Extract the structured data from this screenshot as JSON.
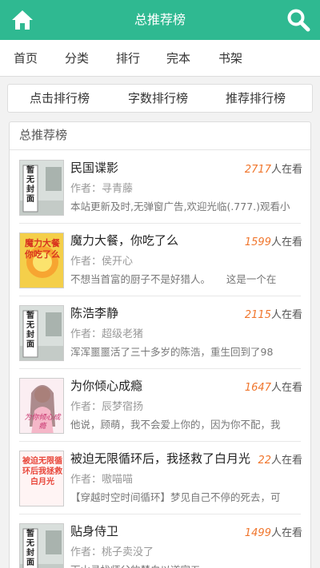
{
  "header": {
    "title": "总推荐榜"
  },
  "nav": [
    "首页",
    "分类",
    "排行",
    "完本",
    "书架"
  ],
  "tabs": [
    "点击排行榜",
    "字数排行榜",
    "推荐排行榜"
  ],
  "panel": {
    "title": "总推荐榜"
  },
  "views_suffix": "人在看",
  "books": [
    {
      "title": "民国谍影",
      "views": "2717",
      "author": "作者：寻青藤",
      "desc": "本站更新及时,无弹窗广告,欢迎光临(.777.)观看小",
      "cover": "暂无封面"
    },
    {
      "title": "魔力大餐，你吃了么",
      "views": "1599",
      "author": "作者：侯开心",
      "desc": "不想当首富的厨子不是好猎人。     这是一个在",
      "cover": "魔力大餐你吃了么"
    },
    {
      "title": "陈浩李静",
      "views": "2115",
      "author": "作者：超级老猪",
      "desc": "浑浑噩噩活了三十多岁的陈浩，重生回到了98",
      "cover": "暂无封面"
    },
    {
      "title": "为你倾心成瘾",
      "views": "1647",
      "author": "作者：辰梦宿扬",
      "desc": "他说，顾萌，我不会爱上你的，因为你不配，我",
      "cover": "为你倾心成瘾"
    },
    {
      "title": "被迫无限循环后，我拯救了白月光",
      "views": "22",
      "author": "作者：嗷喵喵",
      "desc": "【穿越时空时间循环】梦见自己不停的死去，可",
      "cover": "被迫无限循环后我拯救白月光"
    },
    {
      "title": "贴身侍卫",
      "views": "1499",
      "author": "作者：桃子卖没了",
      "desc": "下山寻找师父的楚白以道家五",
      "cover": "暂无封面"
    }
  ]
}
